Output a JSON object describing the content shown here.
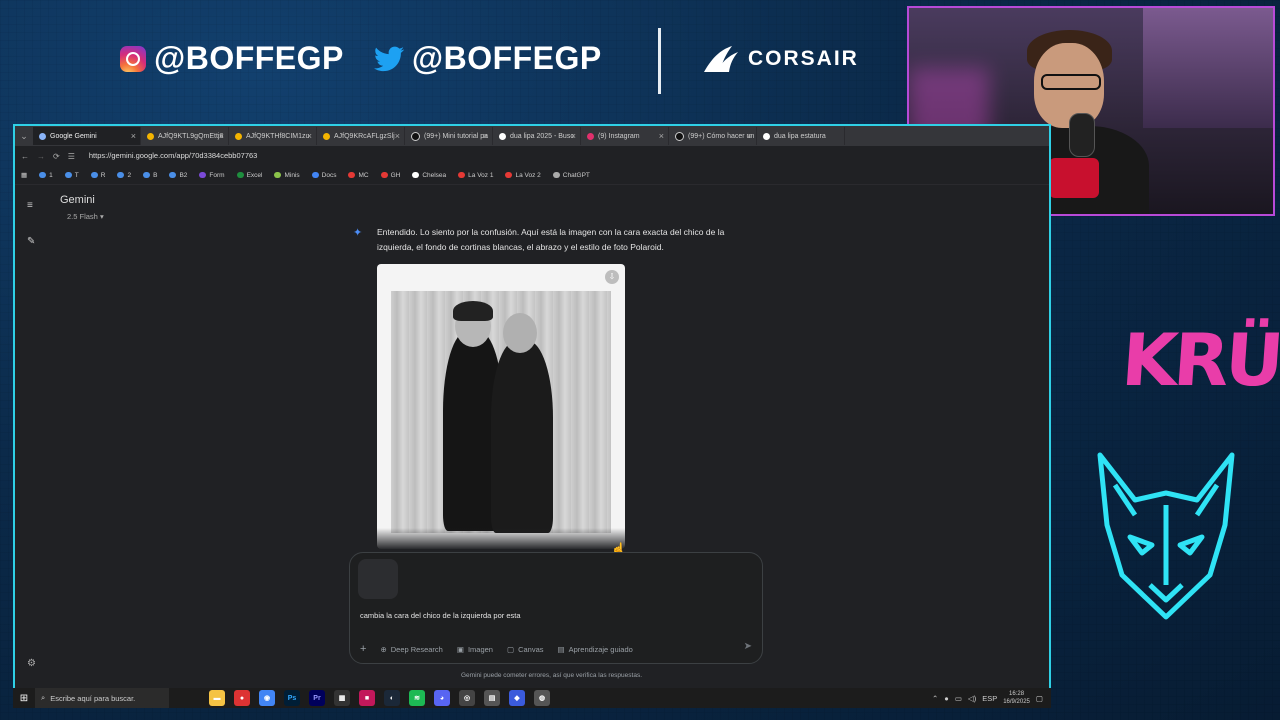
{
  "overlay": {
    "instagram_handle": "@BOFFEGP",
    "twitter_handle": "@BOFFEGP",
    "sponsor": "CORSAIR",
    "team": "KRÜ",
    "accent_color": "#2fd0e6",
    "brand_pink": "#e93da9"
  },
  "browser": {
    "tabs": [
      {
        "label": "Google Gemini",
        "active": true
      },
      {
        "label": "AJfQ9KTL9gQmEttj6"
      },
      {
        "label": "AJfQ9KTHf8CIM1zu"
      },
      {
        "label": "AJfQ9KRcAFLgzSlj"
      },
      {
        "label": "(99+) Mini tutorial pa"
      },
      {
        "label": "dua lipa 2025 - Busc"
      },
      {
        "label": "(9) Instagram"
      },
      {
        "label": "(99+) Cómo hacer un"
      },
      {
        "label": "dua lipa estatura"
      }
    ],
    "url": "https://gemini.google.com/app/70d3384cebb07763",
    "bookmarks": [
      "1",
      "T",
      "R",
      "2",
      "B",
      "B2",
      "Form",
      "Excel",
      "Minis",
      "Docs",
      "MC",
      "GH",
      "Chelsea",
      "La Voz 1",
      "La Voz 2",
      "ChatGPT"
    ]
  },
  "gemini": {
    "title": "Gemini",
    "model": "2.5 Flash",
    "response": "Entendido. Lo siento por la confusión. Aquí está la imagen con la cara exacta del chico de la izquierda, el fondo de cortinas blancas, el abrazo y el estilo de foto Polaroid.",
    "prompt_text": "cambia la cara del chico de la izquierda por esta",
    "tools": [
      "Deep Research",
      "Imagen",
      "Canvas",
      "Aprendizaje guiado"
    ],
    "disclaimer": "Gemini puede cometer errores, así que verifica las respuestas."
  },
  "taskbar": {
    "search_placeholder": "Escribe aquí para buscar.",
    "language": "ESP",
    "time": "16:28",
    "date": "16/9/2025"
  }
}
